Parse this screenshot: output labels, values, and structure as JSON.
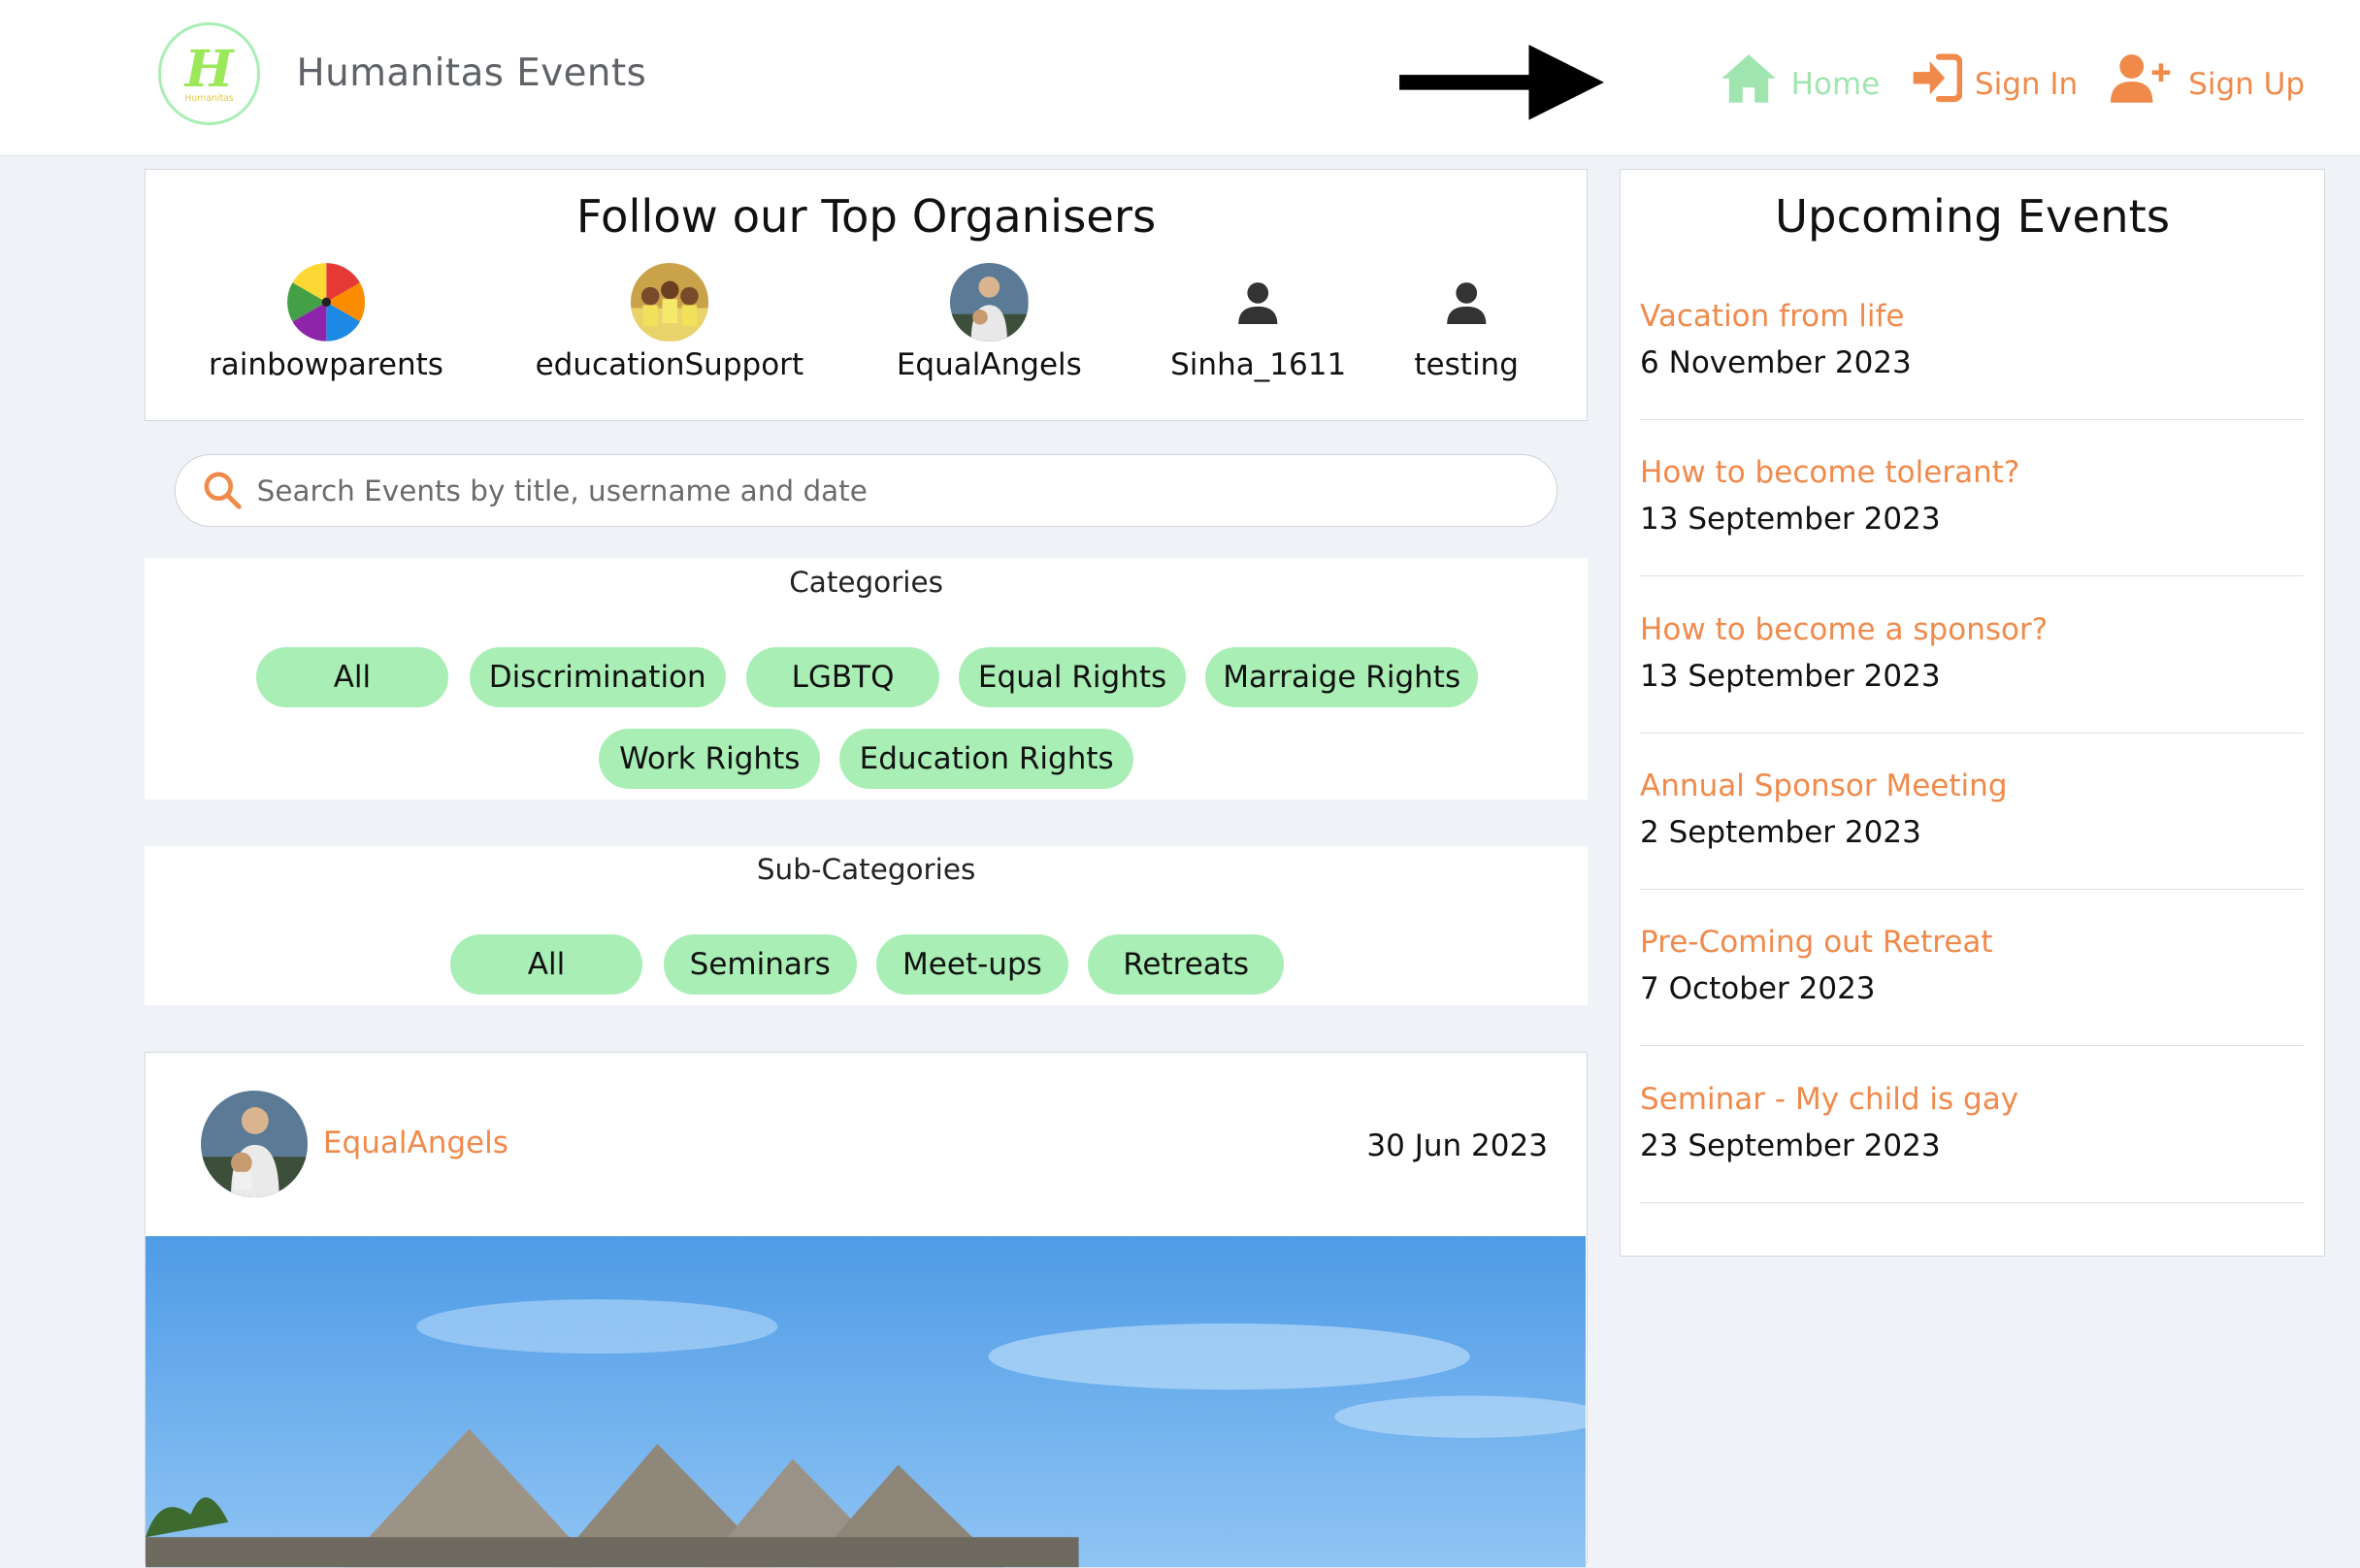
{
  "header": {
    "brand": "Humanitas Events",
    "logo_letter": "H",
    "logo_sub": "Humanitas",
    "nav": {
      "home": "Home",
      "sign_in": "Sign In",
      "sign_up": "Sign Up"
    },
    "colors": {
      "home": "#a0e5b0",
      "accent": "#f08a4b"
    }
  },
  "organisers": {
    "title": "Follow our Top Organisers",
    "items": [
      {
        "name": "rainbowparents",
        "avatar": "rainbow-wheel"
      },
      {
        "name": "educationSupport",
        "avatar": "group-photo"
      },
      {
        "name": "EqualAngels",
        "avatar": "person-photo"
      },
      {
        "name": "Sinha_1611",
        "avatar": "person-icon"
      },
      {
        "name": "testing",
        "avatar": "person-icon"
      }
    ]
  },
  "search": {
    "placeholder": "Search Events by title, username and date",
    "value": ""
  },
  "categories": {
    "heading": "Categories",
    "items": [
      "All",
      "Discrimination",
      "LGBTQ",
      "Equal Rights",
      "Marraige Rights",
      "Work Rights",
      "Education Rights"
    ]
  },
  "subcategories": {
    "heading": "Sub-Categories",
    "items": [
      "All",
      "Seminars",
      "Meet-ups",
      "Retreats"
    ]
  },
  "post": {
    "username": "EqualAngels",
    "date": "30 Jun 2023"
  },
  "upcoming": {
    "title": "Upcoming Events",
    "events": [
      {
        "title": "Vacation from life",
        "date": "6 November 2023"
      },
      {
        "title": "How to become tolerant?",
        "date": "13 September 2023"
      },
      {
        "title": "How to become a sponsor?",
        "date": "13 September 2023"
      },
      {
        "title": "Annual Sponsor Meeting",
        "date": "2 September 2023"
      },
      {
        "title": "Pre-Coming out Retreat",
        "date": "7 October 2023"
      },
      {
        "title": "Seminar - My child is gay",
        "date": "23 September 2023"
      }
    ]
  }
}
